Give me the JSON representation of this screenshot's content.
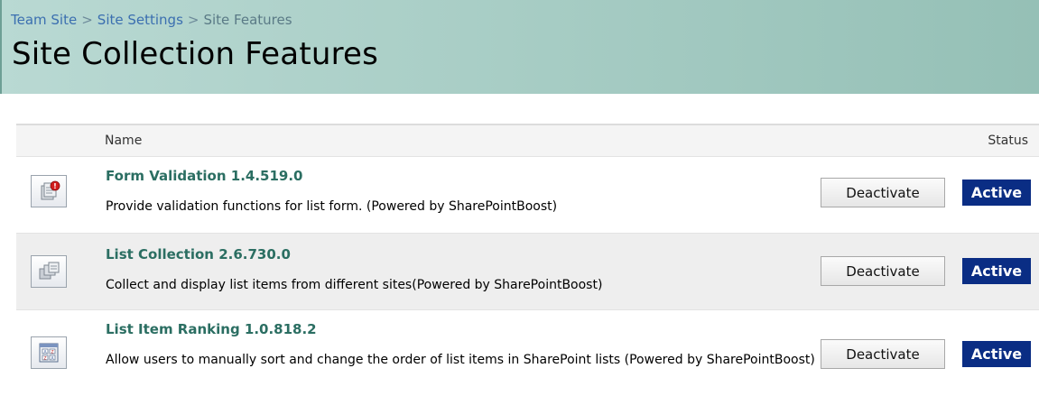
{
  "breadcrumb": {
    "items": [
      "Team Site",
      "Site Settings",
      "Site Features"
    ],
    "separator": ">"
  },
  "page_title": "Site Collection Features",
  "table": {
    "header_name": "Name",
    "header_status": "Status"
  },
  "features": [
    {
      "title": "Form Validation 1.4.519.0",
      "description": "Provide validation functions for list form. (Powered by SharePointBoost)",
      "button_label": "Deactivate",
      "status": "Active",
      "icon": "form-validation-icon"
    },
    {
      "title": "List Collection 2.6.730.0",
      "description": "Collect and display list items from different sites(Powered by SharePointBoost)",
      "button_label": "Deactivate",
      "status": "Active",
      "icon": "list-collection-icon"
    },
    {
      "title": "List Item Ranking 1.0.818.2",
      "description": "Allow users to manually sort and change the order of list items in SharePoint lists (Powered by SharePointBoost)",
      "button_label": "Deactivate",
      "status": "Active",
      "icon": "list-item-ranking-icon"
    }
  ],
  "colors": {
    "title_bar": "#a9cec6",
    "link": "#3b6fb0",
    "feature_title": "#2b6e62",
    "status_badge": "#0a2d84"
  }
}
